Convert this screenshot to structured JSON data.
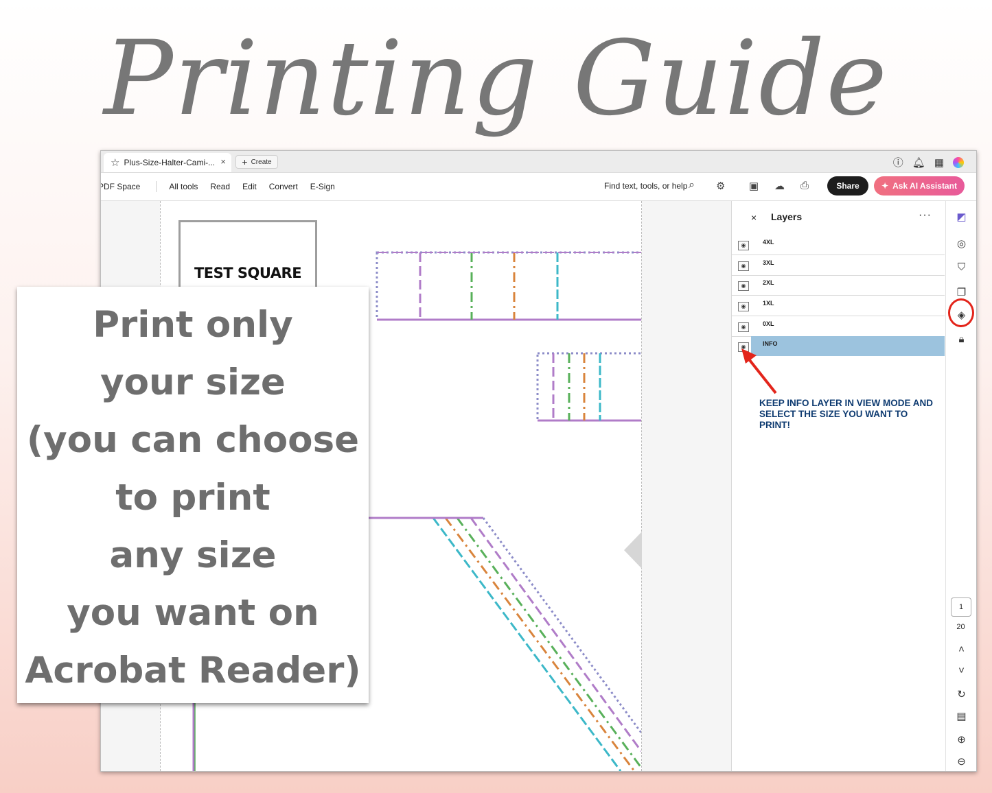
{
  "headline": "Printing Guide",
  "overlay": {
    "lines": [
      "Print only",
      "your size",
      "(you can choose",
      "to print",
      "any size",
      "you want on",
      "Acrobat Reader)"
    ]
  },
  "browser": {
    "tab_title": "Plus-Size-Halter-Cami-...",
    "tab_close": "×",
    "create_label": "Create"
  },
  "toolbar": {
    "menu": [
      "PDF Space",
      "All tools",
      "Read",
      "Edit",
      "Convert",
      "E-Sign"
    ],
    "find_placeholder": "Find text, tools, or help",
    "share_label": "Share",
    "ai_label": "Ask AI Assistant"
  },
  "document": {
    "test_square_label": "TEST SQUARE"
  },
  "layers": {
    "title": "Layers",
    "close": "×",
    "more": "···",
    "items": [
      {
        "name": "4XL",
        "selected": false
      },
      {
        "name": "3XL",
        "selected": false
      },
      {
        "name": "2XL",
        "selected": false
      },
      {
        "name": "1XL",
        "selected": false
      },
      {
        "name": "0XL",
        "selected": false
      },
      {
        "name": "INFO",
        "selected": true
      }
    ],
    "note": "KEEP INFO LAYER IN VIEW MODE AND SELECT THE SIZE YOU WANT TO PRINT!"
  },
  "pagination": {
    "current": "1",
    "total": "20"
  },
  "colors": {
    "accent_red": "#e3251b",
    "layer_highlight": "#9cc3de",
    "note_text": "#0d3a70",
    "ai_button": "#f07080"
  }
}
